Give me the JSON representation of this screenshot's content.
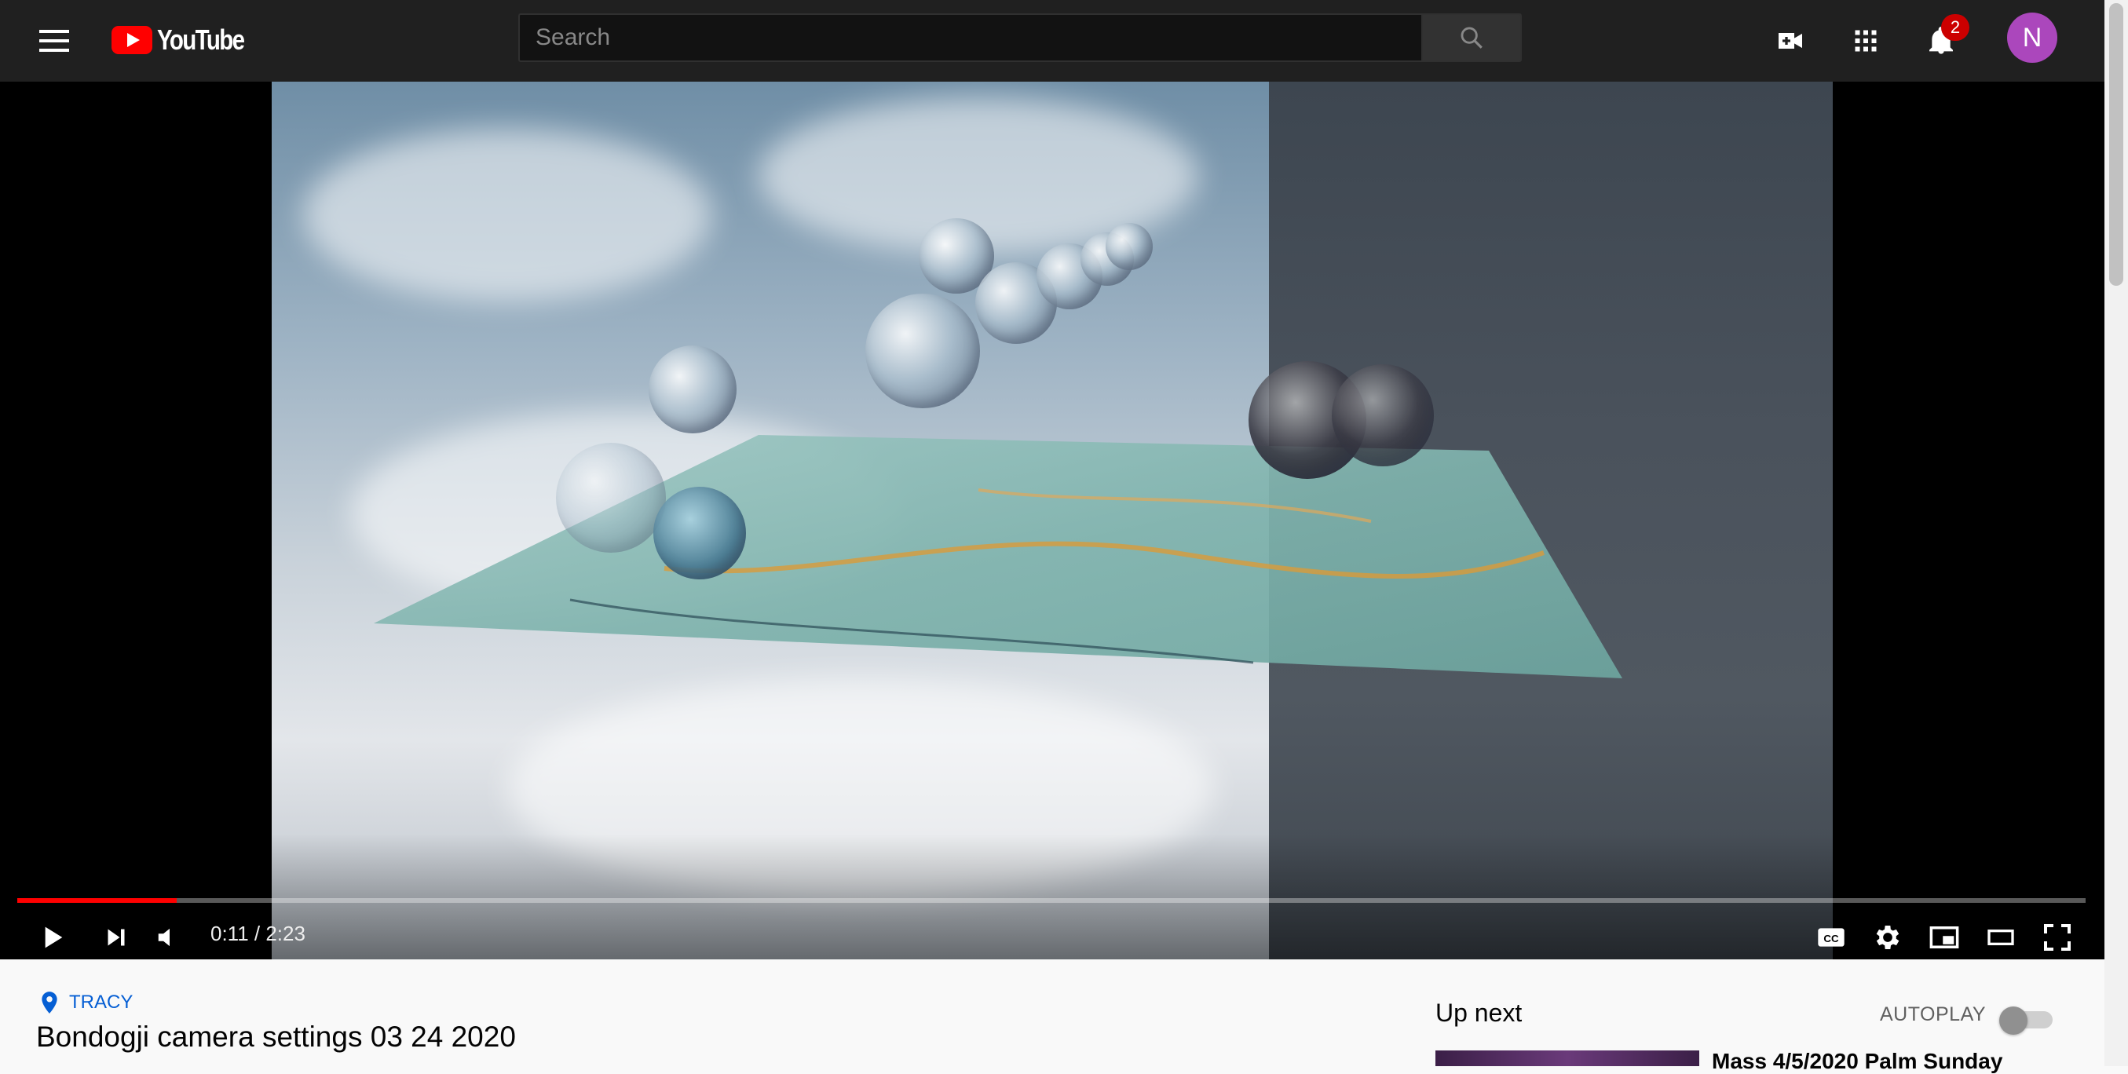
{
  "masthead": {
    "logo_text": "YouTube",
    "search_placeholder": "Search",
    "notification_count": "2",
    "avatar_letter": "N"
  },
  "player": {
    "current_time": "0:11",
    "duration": "2:23",
    "time_display": "0:11 / 2:23",
    "progress": 0.077,
    "accent_color": "#ff0000"
  },
  "video": {
    "location": "TRACY",
    "title": "Bondogji camera settings 03 24 2020"
  },
  "sidebar": {
    "up_next_label": "Up next",
    "autoplay_label": "AUTOPLAY",
    "autoplay_on": false,
    "next_video_title": "Mass 4/5/2020 Palm Sunday"
  },
  "icons": {
    "menu": "menu-icon",
    "search": "search-icon",
    "create": "video-camera-plus-icon",
    "apps": "apps-grid-icon",
    "notifications": "bell-icon",
    "play": "play-icon",
    "next": "skip-next-icon",
    "volume": "volume-muted-icon",
    "captions": "cc-icon",
    "settings": "gear-icon",
    "miniplayer": "miniplayer-icon",
    "theater": "theater-mode-icon",
    "fullscreen": "fullscreen-icon",
    "location": "location-pin-icon"
  }
}
